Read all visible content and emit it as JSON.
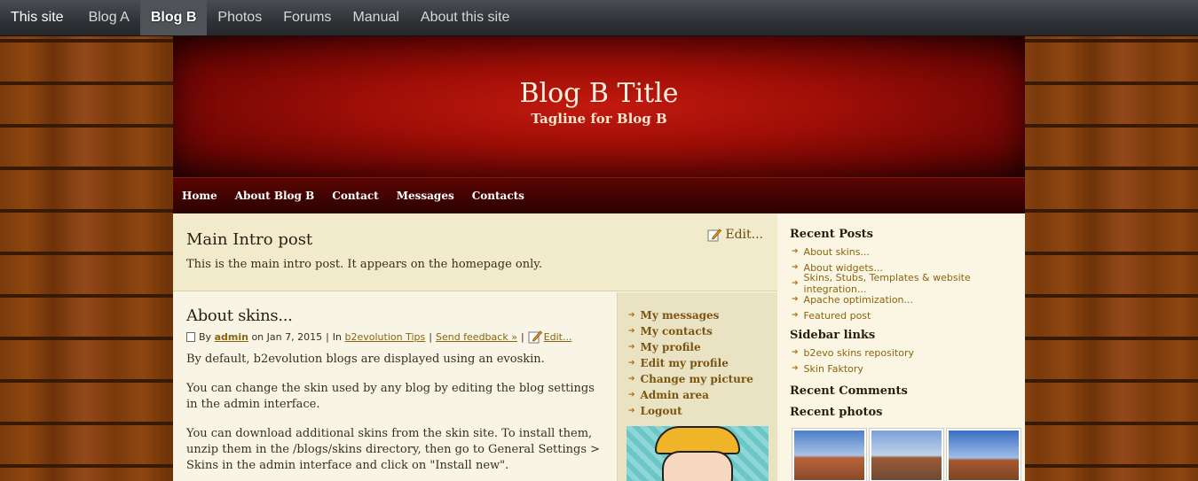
{
  "sitebar": {
    "items": [
      "This site",
      "Blog A",
      "Blog B",
      "Photos",
      "Forums",
      "Manual",
      "About this site"
    ],
    "active": "Blog B"
  },
  "header": {
    "title": "Blog B Title",
    "tagline": "Tagline for Blog B"
  },
  "menu": {
    "items": [
      "Home",
      "About Blog B",
      "Contact",
      "Messages",
      "Contacts"
    ]
  },
  "intro": {
    "title": "Main Intro post",
    "text": "This is the main intro post. It appears on the homepage only.",
    "edit_label": "Edit..."
  },
  "post": {
    "title": "About skins...",
    "by": "By",
    "author": "admin",
    "date": "on Jan 7, 2015",
    "in": "In",
    "category": "b2evolution Tips",
    "feedback": "Send feedback »",
    "edit_label": "Edit...",
    "paragraphs": [
      "By default, b2evolution blogs are displayed using an evoskin.",
      "You can change the skin used by any blog by editing the blog settings in the admin interface.",
      "You can download additional skins from the skin site. To install them, unzip them in the /blogs/skins directory, then go to General Settings > Skins in the admin interface and click on \"Install new\"."
    ]
  },
  "userbox": {
    "items": [
      "My messages",
      "My contacts",
      "My profile",
      "Edit my profile",
      "Change my picture",
      "Admin area",
      "Logout"
    ]
  },
  "sidebar": {
    "recent_posts_title": "Recent Posts",
    "recent_posts": [
      "About skins...",
      "About widgets...",
      "Skins, Stubs, Templates & website integration...",
      "Apache optimization...",
      "Featured post"
    ],
    "links_title": "Sidebar links",
    "links": [
      "b2evo skins repository",
      "Skin Faktory"
    ],
    "comments_title": "Recent Comments",
    "photos_title": "Recent photos"
  }
}
